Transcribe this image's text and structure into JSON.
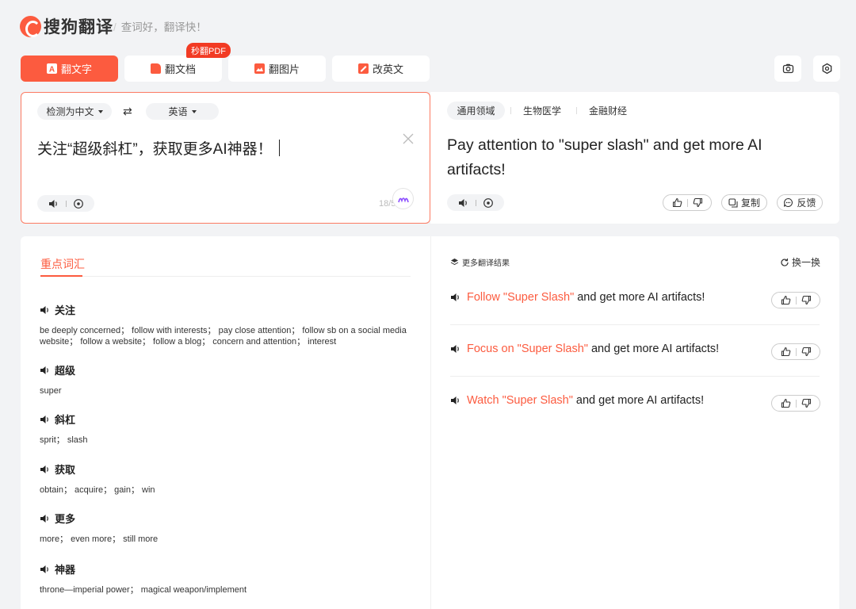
{
  "app": {
    "name": "搜狗翻译",
    "slogan": "查词好，翻译快！"
  },
  "tabs": [
    {
      "label": "翻文字",
      "active": true
    },
    {
      "label": "翻文档",
      "active": false
    },
    {
      "label": "翻图片",
      "active": false
    },
    {
      "label": "改英文",
      "active": false
    }
  ],
  "pdf_badge": "秒翻PDF",
  "toolbar_icons": [
    "camera-icon",
    "settings-icon"
  ],
  "source": {
    "lang": "检测为中文",
    "target_lang": "英语",
    "text": "关注“超级斜杠”，获取更多AI神器！",
    "counter": "18/5",
    "counter_suffix": "5"
  },
  "target": {
    "domains": [
      "通用领域",
      "生物医学",
      "金融财经"
    ],
    "text": "Pay attention to \"super slash\" and get more AI artifacts!",
    "copy_label": "复制",
    "feedback_label": "反馈"
  },
  "vocab": {
    "tab_label": "重点词汇",
    "items": [
      {
        "word": "关注",
        "def": "be deeply concerned； follow with interests； pay close attention； follow sb on a social media website； follow a website； follow a blog； concern and attention； interest"
      },
      {
        "word": "超级",
        "def": "super"
      },
      {
        "word": "斜杠",
        "def": "sprit； slash"
      },
      {
        "word": "获取",
        "def": "obtain； acquire； gain； win"
      },
      {
        "word": "更多",
        "def": "more； even more； still more"
      },
      {
        "word": "神器",
        "def": "throne—imperial power； magical weapon/implement"
      }
    ]
  },
  "more": {
    "title": "更多翻译结果",
    "refresh_label": "换一换",
    "items": [
      {
        "hl": "Follow \"Super Slash\"",
        "rest": " and get more AI artifacts!"
      },
      {
        "hl": "Focus on \"Super Slash\"",
        "rest": " and get more AI artifacts!"
      },
      {
        "hl": "Watch \"Super Slash\"",
        "rest": " and get more AI artifacts!"
      }
    ]
  },
  "colors": {
    "accent": "#fc5b3f",
    "background": "#f2f3f5"
  }
}
